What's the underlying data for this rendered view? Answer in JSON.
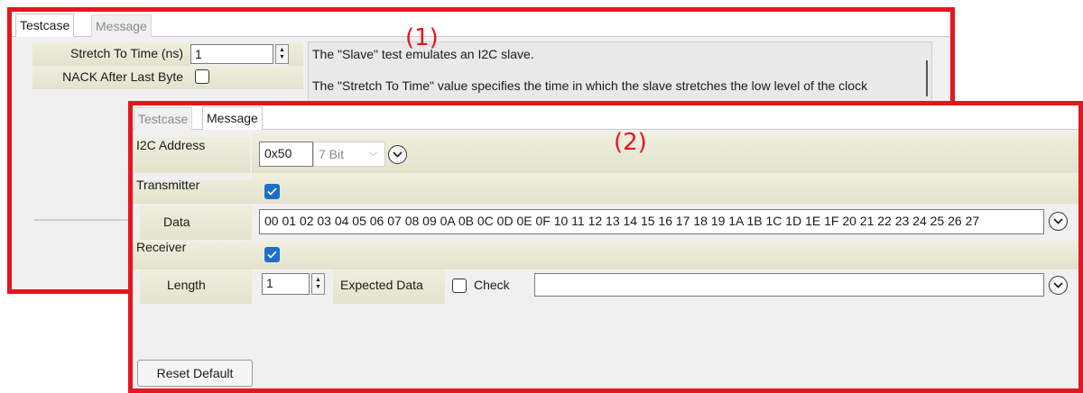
{
  "annotations": {
    "panel1": "(1)",
    "panel2": "(2)"
  },
  "panel1": {
    "tabs": [
      {
        "label": "Testcase",
        "active": true
      },
      {
        "label": "Message",
        "active": false
      }
    ],
    "stretch_label": "Stretch To Time (ns)",
    "stretch_value": "1",
    "nack_label": "NACK After Last Byte",
    "nack_checked": false,
    "description_line1": "The \"Slave\" test emulates an I2C slave.",
    "description_line2": "The \"Stretch To Time\" value specifies the time in which the slave stretches the low level of the clock"
  },
  "panel2": {
    "tabs": [
      {
        "label": "Testcase",
        "active": false
      },
      {
        "label": "Message",
        "active": true
      }
    ],
    "i2c_address_label": "I2C Address",
    "i2c_address_value": "0x50",
    "bit_mode": "7 Bit",
    "transmitter_label": "Transmitter",
    "transmitter_checked": true,
    "data_label": "Data",
    "data_value": "00 01 02 03 04 05 06 07 08 09 0A 0B 0C 0D 0E 0F 10 11 12 13 14 15 16 17 18 19 1A 1B 1C 1D 1E 1F 20 21 22 23 24 25 26 27",
    "receiver_label": "Receiver",
    "receiver_checked": true,
    "length_label": "Length",
    "length_value": "1",
    "expected_data_label": "Expected Data",
    "check_label": "Check",
    "check_checked": false,
    "expected_data_value": "",
    "reset_button": "Reset Default"
  },
  "colors": {
    "highlight_border": "#e8141e",
    "checkbox_blue": "#1f6fc5",
    "label_beige": "#e6e6d2"
  },
  "icons": [
    "chevron-down-circle-icon",
    "spin-up-icon",
    "spin-down-icon",
    "checkmark-icon",
    "dropdown-arrow-icon"
  ]
}
